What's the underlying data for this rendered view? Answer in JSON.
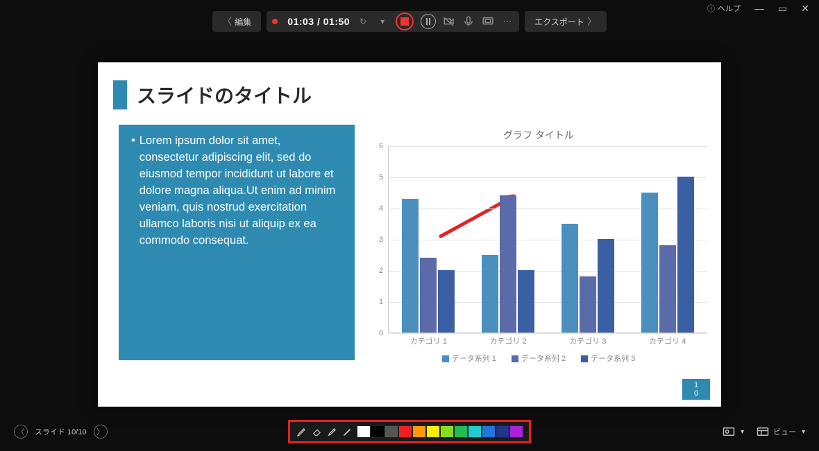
{
  "titlebar": {
    "help_label": "ヘルプ"
  },
  "topbar": {
    "edit_label": "編集",
    "time_current": "01:03",
    "time_total": "01:50",
    "export_label": "エクスポート"
  },
  "slide": {
    "title": "スライドのタイトル",
    "bullet_text": "Lorem ipsum dolor sit amet, consectetur adipiscing elit, sed do eiusmod tempor incididunt ut labore et dolore magna aliqua.Ut enim ad minim veniam, quis nostrud exercitation ullamco laboris nisi ut aliquip ex ea commodo consequat.",
    "page_num_top": "1",
    "page_num_bot": "0"
  },
  "chart_data": {
    "type": "bar",
    "title": "グラフ タイトル",
    "categories": [
      "カテゴリ 1",
      "カテゴリ 2",
      "カテゴリ 3",
      "カテゴリ 4"
    ],
    "series": [
      {
        "name": "データ系列 1",
        "values": [
          4.3,
          2.5,
          3.5,
          4.5
        ],
        "color": "#4b8fbe"
      },
      {
        "name": "データ系列 2",
        "values": [
          2.4,
          4.4,
          1.8,
          2.8
        ],
        "color": "#5b6aa8"
      },
      {
        "name": "データ系列 3",
        "values": [
          2.0,
          2.0,
          3.0,
          5.0
        ],
        "color": "#3a5fa2"
      }
    ],
    "ylim": [
      0,
      6
    ],
    "yticks": [
      0,
      1,
      2,
      3,
      4,
      5,
      6
    ],
    "xlabel": "",
    "ylabel": ""
  },
  "bottombar": {
    "slide_counter": "スライド 10/10",
    "view_label": "ビュー"
  },
  "colors": {
    "swatches": [
      "#ffffff",
      "#000000",
      "#555555",
      "#ee2222",
      "#ff9900",
      "#ffee00",
      "#88dd22",
      "#22bb55",
      "#22cccc",
      "#2277dd",
      "#223388",
      "#aa22dd"
    ]
  }
}
